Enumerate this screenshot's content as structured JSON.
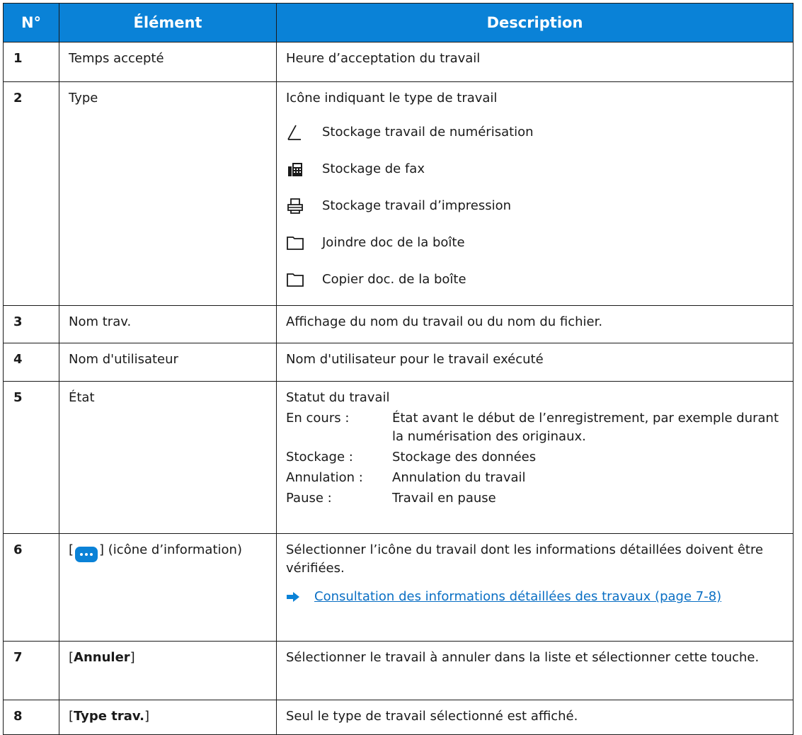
{
  "header": {
    "num": "N°",
    "element": "Élément",
    "description": "Description"
  },
  "rows": [
    {
      "num": "1",
      "element": "Temps accepté",
      "description": "Heure d’acceptation du travail"
    },
    {
      "num": "2",
      "element": "Type",
      "description": "Icône indiquant le type de travail",
      "types": [
        {
          "icon": "scan-icon",
          "label": "Stockage travail de numérisation"
        },
        {
          "icon": "fax-icon",
          "label": "Stockage de fax"
        },
        {
          "icon": "printer-icon",
          "label": "Stockage travail d’impression"
        },
        {
          "icon": "folder-icon",
          "label": "Joindre doc de la boîte"
        },
        {
          "icon": "folder-icon",
          "label": "Copier doc. de la boîte"
        }
      ]
    },
    {
      "num": "3",
      "element": "Nom trav.",
      "description": "Affichage du nom du travail ou du nom du fichier."
    },
    {
      "num": "4",
      "element": "Nom d'utilisateur",
      "description": "Nom d'utilisateur pour le travail exécuté"
    },
    {
      "num": "5",
      "element": "État",
      "description": "Statut du travail",
      "statuses": [
        {
          "label": "En cours :",
          "text": "État avant le début de l’enregistrement, par exemple durant la numérisation des originaux."
        },
        {
          "label": "Stockage :",
          "text": "Stockage des données"
        },
        {
          "label": "Annulation :",
          "text": "Annulation du travail"
        },
        {
          "label": "Pause :",
          "text": "Travail en pause"
        }
      ]
    },
    {
      "num": "6",
      "element_before": "[",
      "element_after": "] (icône d’information)",
      "description": "Sélectionner l’icône du travail dont les informations détaillées doivent être vérifiées.",
      "link": "Consultation des informations détaillées des travaux (page 7-8)"
    },
    {
      "num": "7",
      "element_bracket_open": "[",
      "element_bold": "Annuler",
      "element_bracket_close": "]",
      "description": "Sélectionner le travail à annuler dans la liste et sélectionner cette touche."
    },
    {
      "num": "8",
      "element_bracket_open": "[",
      "element_bold": "Type trav.",
      "element_bracket_close": "]",
      "description": "Seul le type de travail sélectionné est affiché."
    }
  ],
  "colors": {
    "header_bg": "#0a82d7",
    "link": "#0a6fc4"
  }
}
